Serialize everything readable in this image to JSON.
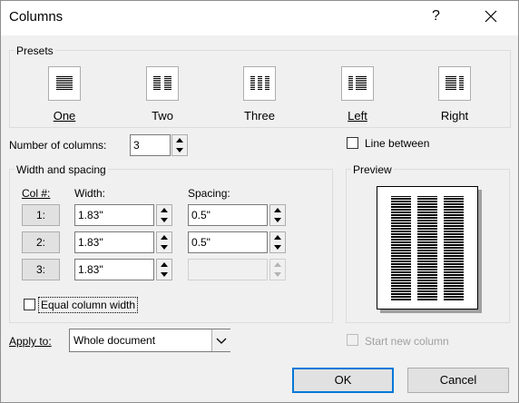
{
  "dialog": {
    "title": "Columns",
    "help_glyph": "?",
    "close_glyph": "✕"
  },
  "presets": {
    "label": "Presets",
    "items": [
      {
        "label": "One"
      },
      {
        "label": "Two"
      },
      {
        "label": "Three"
      },
      {
        "label": "Left"
      },
      {
        "label": "Right"
      }
    ]
  },
  "number_of_columns": {
    "label": "Number of columns:",
    "value": "3"
  },
  "line_between": {
    "label": "Line between",
    "checked": false
  },
  "width_spacing": {
    "label": "Width and spacing",
    "headers": {
      "col": "Col #:",
      "width": "Width:",
      "spacing": "Spacing:"
    },
    "rows": [
      {
        "col": "1:",
        "width": "1.83\"",
        "spacing": "0.5\""
      },
      {
        "col": "2:",
        "width": "1.83\"",
        "spacing": "0.5\""
      },
      {
        "col": "3:",
        "width": "1.83\"",
        "spacing": ""
      }
    ]
  },
  "equal_column_width": {
    "label": "Equal column width",
    "checked": false
  },
  "preview": {
    "label": "Preview"
  },
  "apply_to": {
    "label": "Apply to:",
    "value": "Whole document"
  },
  "start_new_column": {
    "label": "Start new column",
    "checked": false
  },
  "buttons": {
    "ok": "OK",
    "cancel": "Cancel"
  },
  "colors": {
    "accent": "#0078d7",
    "border": "#adadad",
    "background": "#f0f0f0"
  }
}
